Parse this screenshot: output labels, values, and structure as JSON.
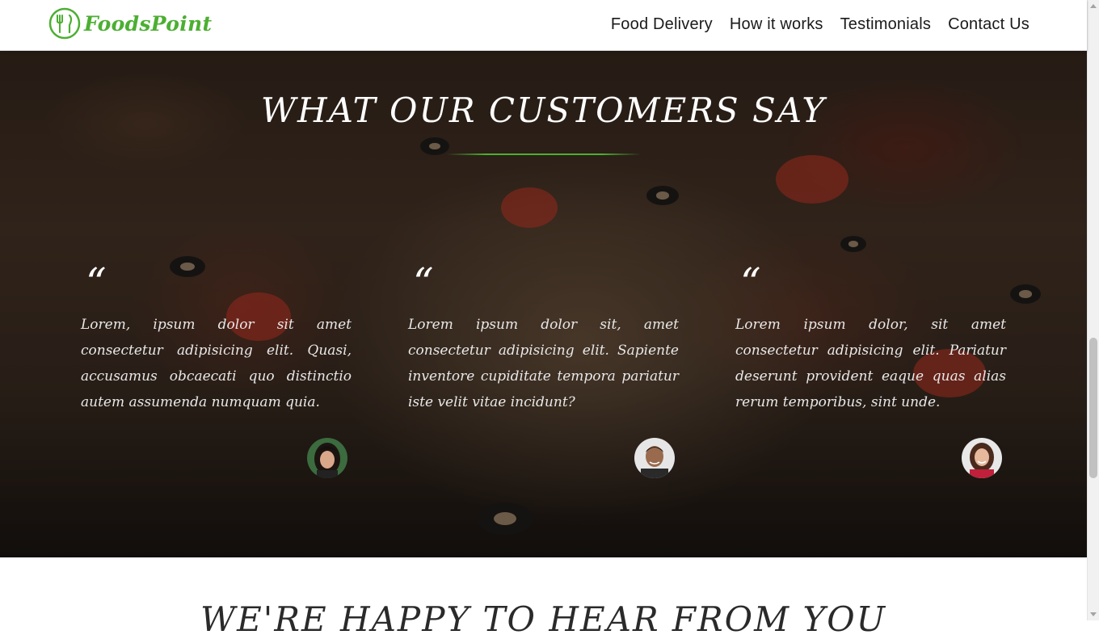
{
  "header": {
    "brand": "FoodsPoint",
    "logo_icon": "fork-knife-icon",
    "nav": [
      {
        "label": "Food Delivery"
      },
      {
        "label": "How it works"
      },
      {
        "label": "Testimonials"
      },
      {
        "label": "Contact Us"
      }
    ]
  },
  "testimonials": {
    "title": "WHAT OUR CUSTOMERS SAY",
    "accent_color": "#4caf32",
    "quote_mark": "“",
    "items": [
      {
        "text": "Lorem, ipsum dolor sit amet consectetur adipisicing elit. Quasi, accusamus obcaecati quo distinctio autem assumenda numquam quia.",
        "avatar": "woman-avatar-1"
      },
      {
        "text": "Lorem ipsum dolor sit, amet consectetur adipisicing elit. Sapiente inventore cupiditate tempora pariatur iste velit vitae incidunt?",
        "avatar": "man-avatar"
      },
      {
        "text": "Lorem ipsum dolor, sit amet consectetur adipisicing elit. Pariatur deserunt provident eaque quas alias rerum temporibus, sint unde.",
        "avatar": "woman-avatar-2"
      }
    ]
  },
  "contact": {
    "title": "WE'RE HAPPY TO HEAR FROM YOU"
  }
}
